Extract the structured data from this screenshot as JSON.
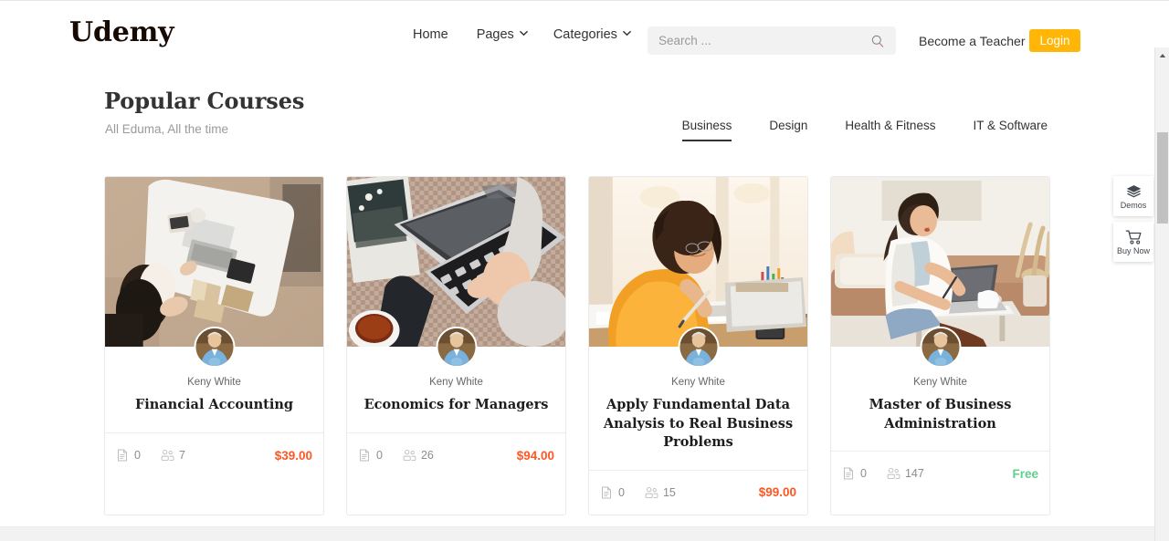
{
  "header": {
    "logo": "Udemy",
    "nav": [
      {
        "label": "Home",
        "has_dropdown": false,
        "icon": ""
      },
      {
        "label": "Pages",
        "has_dropdown": true,
        "icon": "chevron-down-icon"
      },
      {
        "label": "Categories",
        "has_dropdown": true,
        "icon": "chevron-down-icon"
      }
    ],
    "search": {
      "placeholder": "Search ...",
      "value": "",
      "icon": "search-icon"
    },
    "become_teacher_label": "Become a Teacher",
    "login_label": "Login",
    "login_color": "#ffb606"
  },
  "section": {
    "title": "Popular Courses",
    "subtitle": "All Eduma, All the time",
    "tabs": [
      {
        "label": "Business",
        "active": true
      },
      {
        "label": "Design",
        "active": false
      },
      {
        "label": "Health & Fitness",
        "active": false
      },
      {
        "label": "IT & Software",
        "active": false
      }
    ]
  },
  "courses": [
    {
      "instructor": "Keny White",
      "title": "Financial Accounting",
      "lessons": "0",
      "students": "7",
      "price": "$39.00",
      "price_type": "paid",
      "lessons_icon": "document-icon",
      "students_icon": "users-icon",
      "avatar_icon": "instructor-avatar",
      "thumb_name": "desk-laptop-books-photo"
    },
    {
      "instructor": "Keny White",
      "title": "Economics for Managers",
      "lessons": "0",
      "students": "26",
      "price": "$94.00",
      "price_type": "paid",
      "lessons_icon": "document-icon",
      "students_icon": "users-icon",
      "avatar_icon": "instructor-avatar",
      "thumb_name": "typing-laptop-tea-photo"
    },
    {
      "instructor": "Keny White",
      "title": "Apply Fundamental Data Analysis to Real Business Problems",
      "lessons": "0",
      "students": "15",
      "price": "$99.00",
      "price_type": "paid",
      "lessons_icon": "document-icon",
      "students_icon": "users-icon",
      "avatar_icon": "instructor-avatar",
      "thumb_name": "student-writing-window-photo"
    },
    {
      "instructor": "Keny White",
      "title": "Master of Business Administration",
      "lessons": "0",
      "students": "147",
      "price": "Free",
      "price_type": "free",
      "lessons_icon": "document-icon",
      "students_icon": "users-icon",
      "avatar_icon": "instructor-avatar",
      "thumb_name": "woman-couch-laptop-photo"
    }
  ],
  "side_dock": [
    {
      "label": "Demos",
      "icon": "layers-icon"
    },
    {
      "label": "Buy Now",
      "icon": "shopping-cart-icon"
    }
  ],
  "colors": {
    "price_paid": "#ff5722",
    "price_free": "#5fd08b",
    "accent": "#ffb606"
  }
}
